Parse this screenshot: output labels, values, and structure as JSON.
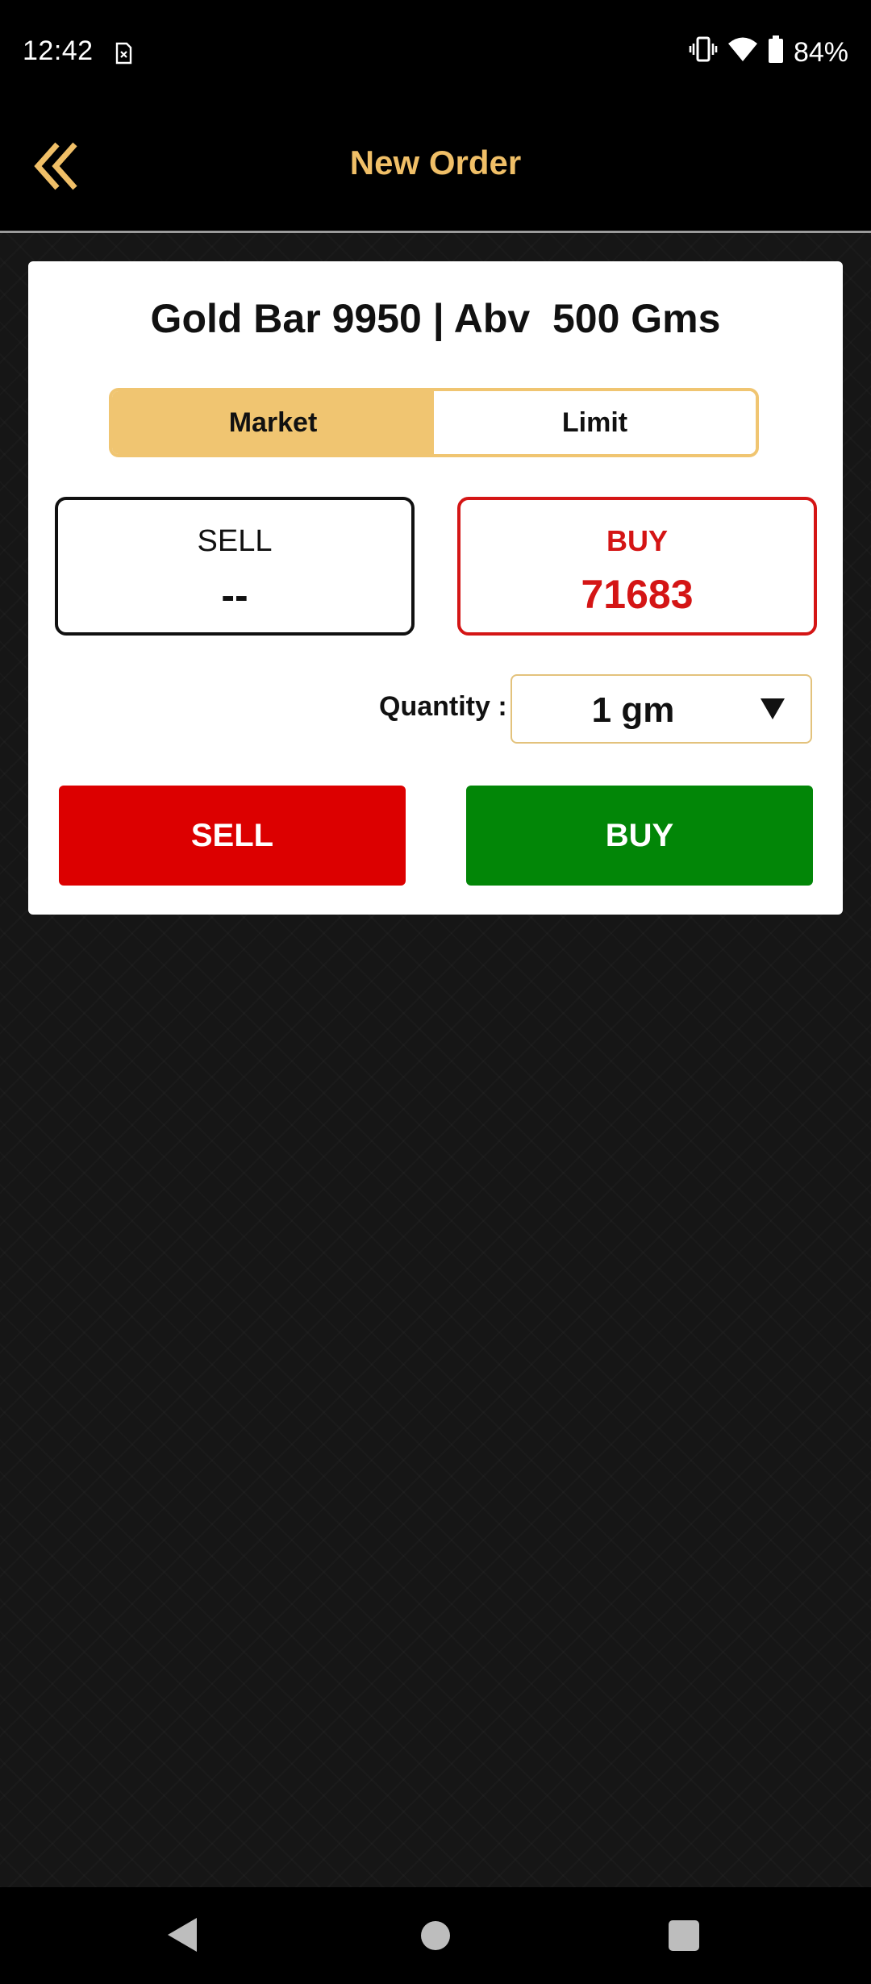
{
  "status_bar": {
    "time": "12:42",
    "battery": "84%",
    "icons": [
      "sim-card-alert-icon",
      "vibrate-icon",
      "wifi-icon",
      "battery-icon"
    ]
  },
  "header": {
    "title": "New Order",
    "back_icon": "double-chevron-left-icon"
  },
  "order": {
    "product": "Gold Bar 9950 | Abv  500 Gms",
    "order_types": [
      "Market",
      "Limit"
    ],
    "selected_order_type": "Market",
    "sell_quote": {
      "label": "SELL",
      "value": "--"
    },
    "buy_quote": {
      "label": "BUY",
      "value": "71683"
    },
    "quantity_label": "Quantity :",
    "quantity_value": "1 gm",
    "sell_button": "SELL",
    "buy_button": "BUY"
  },
  "colors": {
    "accent_gold": "#f0c571",
    "header_title": "#f0bf67",
    "sell_red": "#dc0000",
    "buy_green": "#028607",
    "buy_quote_red": "#d41515"
  },
  "nav_bar": {
    "icons": [
      "back-triangle-icon",
      "home-circle-icon",
      "recents-square-icon"
    ]
  }
}
